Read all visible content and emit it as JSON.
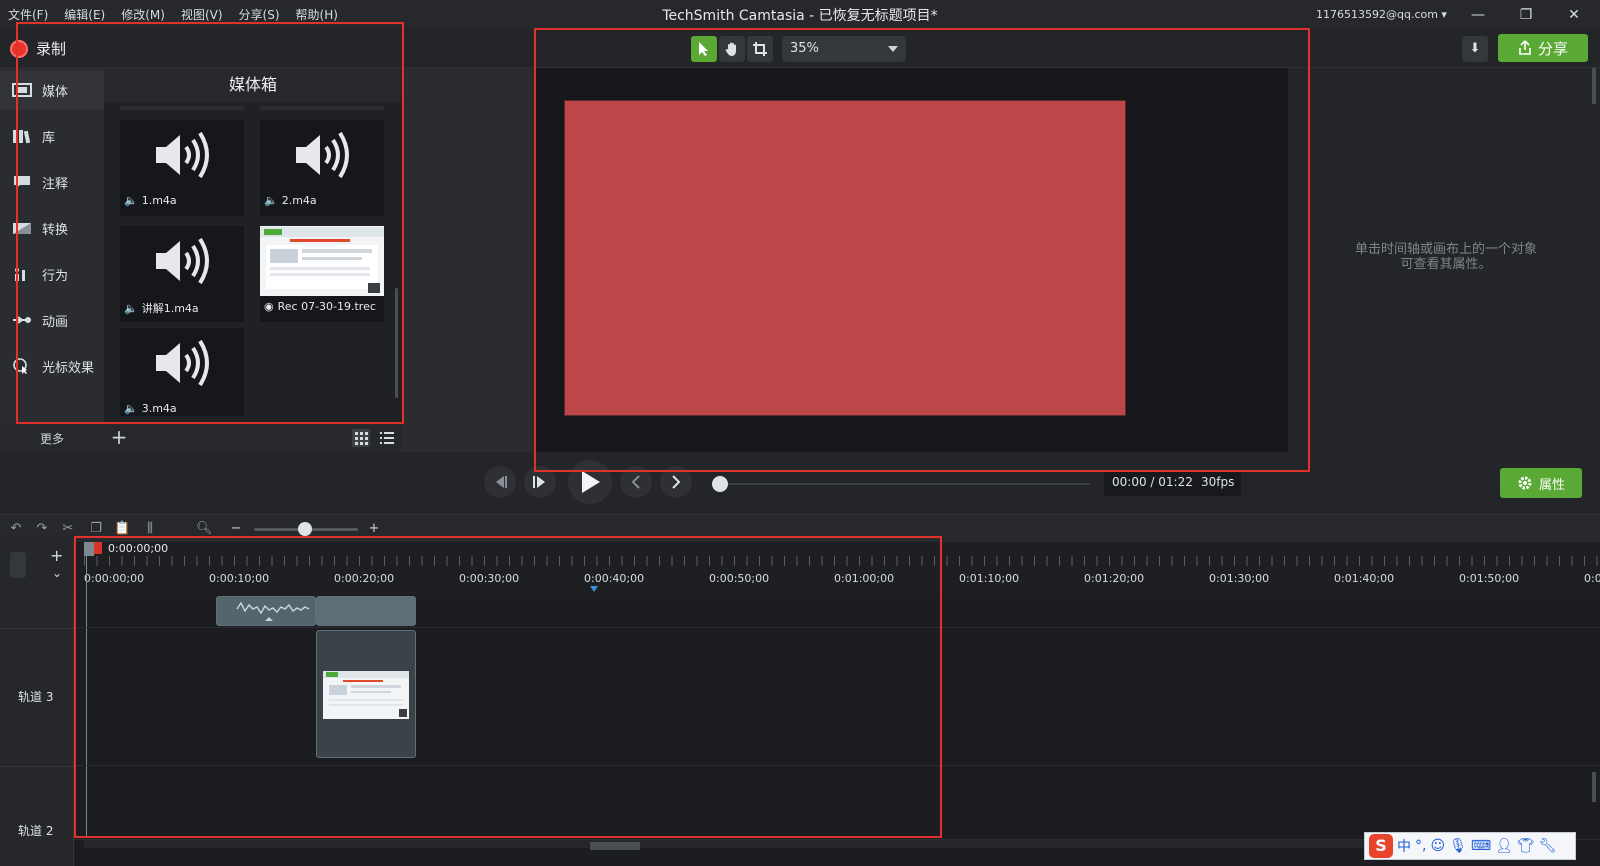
{
  "menu": [
    "文件(F)",
    "编辑(E)",
    "修改(M)",
    "视图(V)",
    "分享(S)",
    "帮助(H)"
  ],
  "app_title": "TechSmith Camtasia - 已恢复无标题项目*",
  "account": "1176513592@qq.com ▾",
  "window_buttons": {
    "minimize": "—",
    "restore": "❐",
    "close": "✕"
  },
  "record_label": "录制",
  "zoom_value": "35%",
  "share_label": "分享",
  "nav": [
    {
      "label": "媒体",
      "icon": "film-icon"
    },
    {
      "label": "库",
      "icon": "library-icon"
    },
    {
      "label": "注释",
      "icon": "annotation-icon"
    },
    {
      "label": "转换",
      "icon": "transition-icon"
    },
    {
      "label": "行为",
      "icon": "behavior-icon"
    },
    {
      "label": "动画",
      "icon": "animation-icon"
    },
    {
      "label": "光标效果",
      "icon": "cursor-effect-icon"
    }
  ],
  "bin": {
    "title": "媒体箱",
    "items": [
      {
        "name": "1.m4a",
        "type": "audio"
      },
      {
        "name": "2.m4a",
        "type": "audio"
      },
      {
        "name": "讲解1.m4a",
        "type": "audio"
      },
      {
        "name": "Rec 07-30-19.trec",
        "type": "recording"
      },
      {
        "name": "3.m4a",
        "type": "audio"
      }
    ],
    "more_label": "更多",
    "add_label": "+"
  },
  "canvas_color": "#bd4748",
  "props_hint_line1": "单击时间轴或画布上的一个对象",
  "props_hint_line2": "可查看其属性。",
  "playback": {
    "time_current": "00:00",
    "time_sep": " / ",
    "time_total": "01:22",
    "fps": "30fps",
    "properties_label": "属性"
  },
  "timeline": {
    "playhead_time": "0:00:00;00",
    "ticks": [
      "0:00:00;00",
      "0:00:10;00",
      "0:00:20;00",
      "0:00:30;00",
      "0:00:40;00",
      "0:00:50;00",
      "0:01:00;00",
      "0:01:10;00",
      "0:01:20;00",
      "0:01:30;00",
      "0:01:40;00",
      "0:01:50;00",
      "0:0"
    ],
    "tracks": [
      "轨道 3",
      "轨道 2"
    ]
  },
  "ime": {
    "logo": "S",
    "mode": "中",
    "punct": "°,"
  },
  "accent_green": "#5aa934",
  "highlight_red": "#e0312b"
}
